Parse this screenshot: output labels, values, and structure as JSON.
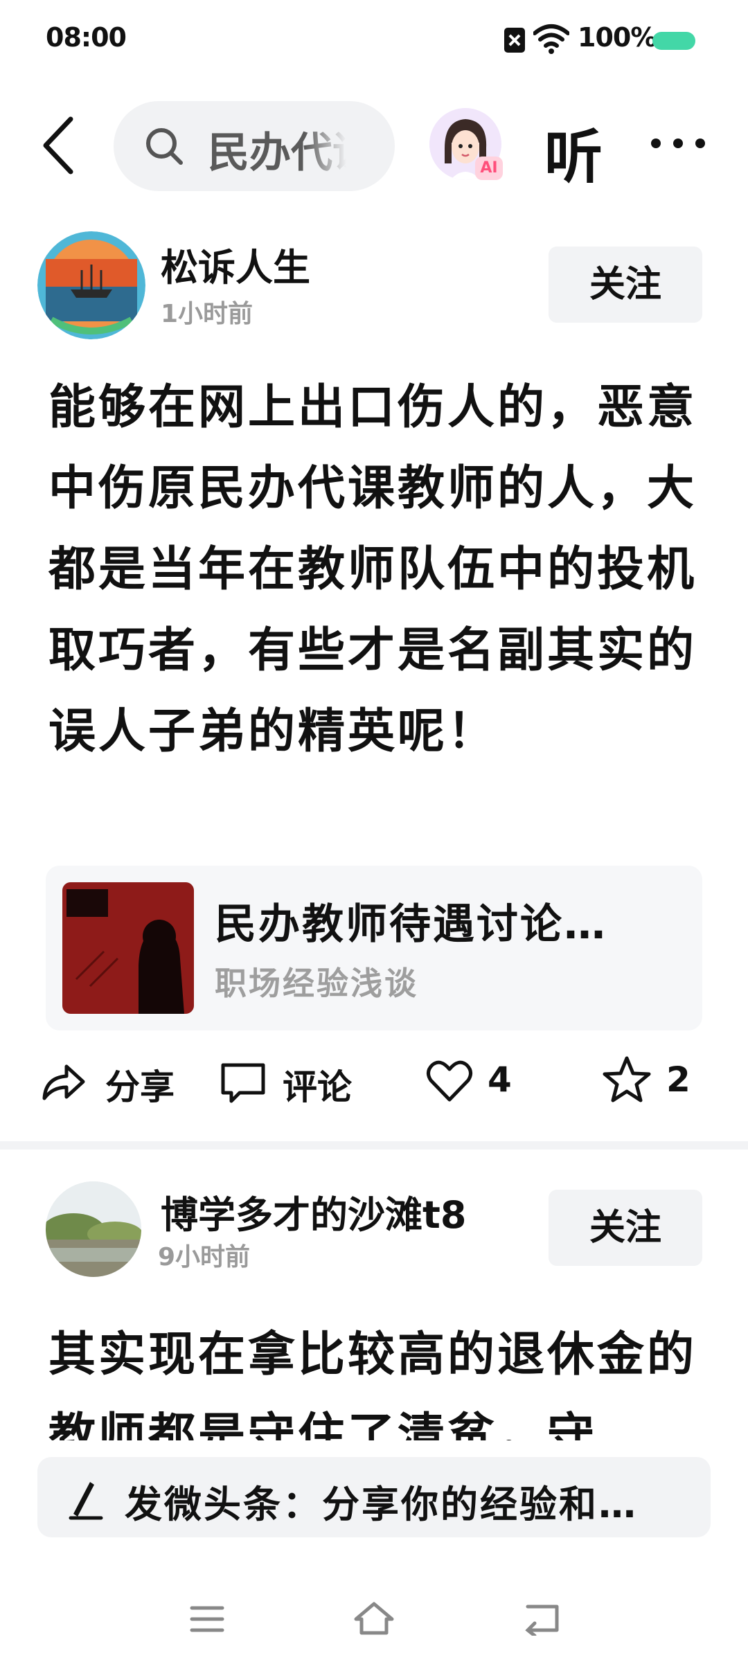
{
  "status_bar": {
    "time": "08:00",
    "battery": "100%"
  },
  "top_nav": {
    "search_text": "民办代课",
    "ai_badge": "AI",
    "listen_label": "听"
  },
  "posts": [
    {
      "author": "松诉人生",
      "time": "1小时前",
      "follow_label": "关注",
      "body": "能够在网上出口伤人的，恶意中伤原民办代课教师的人，大都是当年在教师队伍中的投机取巧者，有些才是名副其实的误人子弟的精英呢！",
      "card": {
        "title": "民办教师待遇讨论…",
        "subtitle": "职场经验浅谈"
      },
      "actions": {
        "share": "分享",
        "comment": "评论",
        "likes": "4",
        "favorites": "2"
      }
    },
    {
      "author": "博学多才的沙滩t8",
      "time": "9小时前",
      "follow_label": "关注",
      "body": "其实现在拿比较高的退休金的教师都是守住了清贫，守"
    }
  ],
  "composer": {
    "placeholder": "发微头条：分享你的经验和…"
  }
}
